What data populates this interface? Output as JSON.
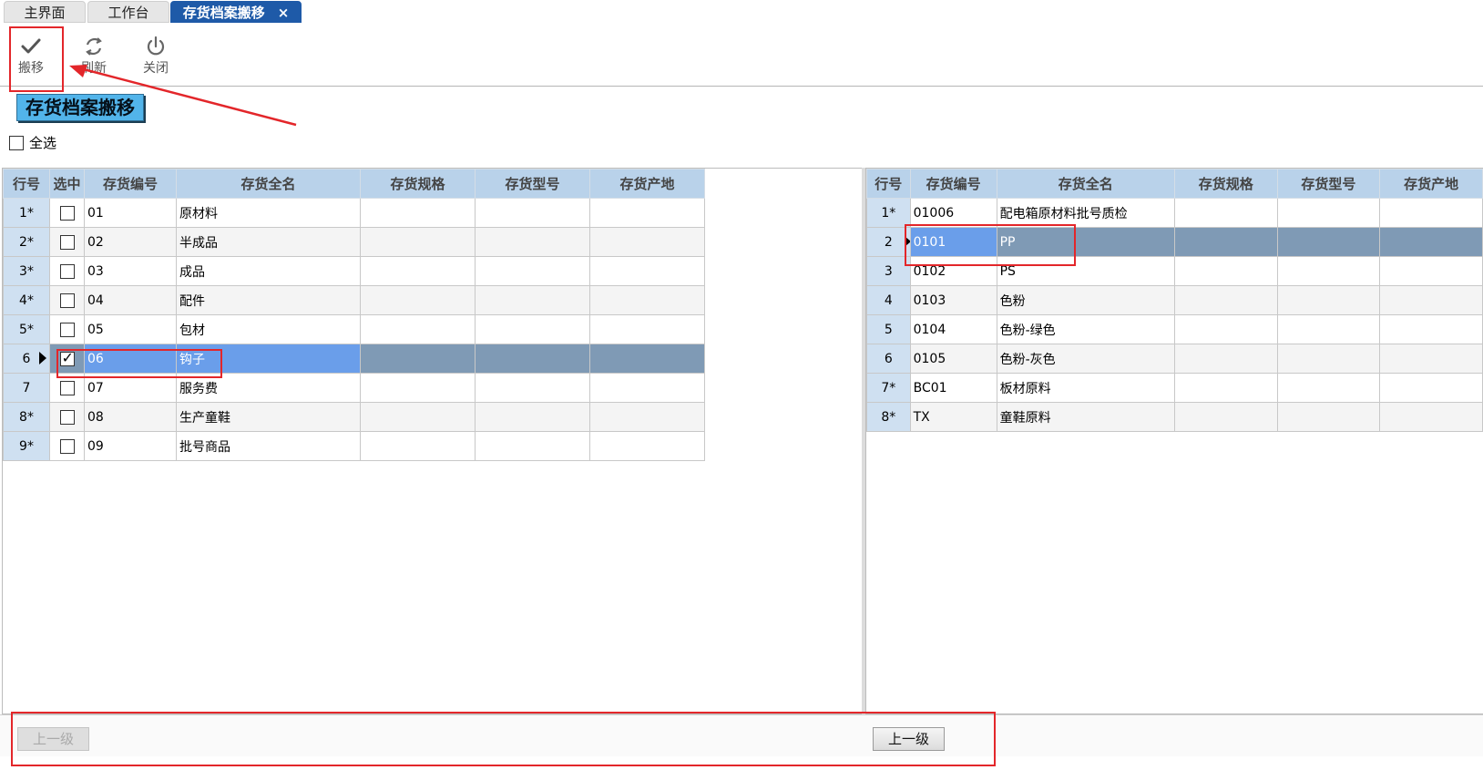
{
  "tabs": [
    {
      "label": "主界面",
      "active": false
    },
    {
      "label": "工作台",
      "active": false
    },
    {
      "label": "存货档案搬移",
      "active": true
    }
  ],
  "tab_close_glyph": "×",
  "toolbar": [
    {
      "label": "搬移",
      "icon": "check-icon"
    },
    {
      "label": "刷新",
      "icon": "refresh-icon"
    },
    {
      "label": "关闭",
      "icon": "power-icon"
    }
  ],
  "page_title": "存货档案搬移",
  "select_all_label": "全选",
  "left_grid": {
    "columns": [
      "行号",
      "选中",
      "存货编号",
      "存货全名",
      "存货规格",
      "存货型号",
      "存货产地"
    ],
    "rows": [
      {
        "rn": "1*",
        "checked": false,
        "code": "01",
        "name": "原材料",
        "spec": "",
        "model": "",
        "origin": ""
      },
      {
        "rn": "2*",
        "checked": false,
        "code": "02",
        "name": "半成品",
        "spec": "",
        "model": "",
        "origin": ""
      },
      {
        "rn": "3*",
        "checked": false,
        "code": "03",
        "name": "成品",
        "spec": "",
        "model": "",
        "origin": ""
      },
      {
        "rn": "4*",
        "checked": false,
        "code": "04",
        "name": "配件",
        "spec": "",
        "model": "",
        "origin": ""
      },
      {
        "rn": "5*",
        "checked": false,
        "code": "05",
        "name": "包材",
        "spec": "",
        "model": "",
        "origin": ""
      },
      {
        "rn": "6",
        "checked": true,
        "code": "06",
        "name": "钩子",
        "spec": "",
        "model": "",
        "origin": "",
        "current": true
      },
      {
        "rn": "7",
        "checked": false,
        "code": "07",
        "name": "服务费",
        "spec": "",
        "model": "",
        "origin": ""
      },
      {
        "rn": "8*",
        "checked": false,
        "code": "08",
        "name": "生产童鞋",
        "spec": "",
        "model": "",
        "origin": ""
      },
      {
        "rn": "9*",
        "checked": false,
        "code": "09",
        "name": "批号商品",
        "spec": "",
        "model": "",
        "origin": ""
      }
    ]
  },
  "right_grid": {
    "columns": [
      "行号",
      "存货编号",
      "存货全名",
      "存货规格",
      "存货型号",
      "存货产地"
    ],
    "rows": [
      {
        "rn": "1*",
        "code": "01006",
        "name": "配电箱原材料批号质检",
        "spec": "",
        "model": "",
        "origin": ""
      },
      {
        "rn": "2",
        "code": "0101",
        "name": "PP",
        "spec": "",
        "model": "",
        "origin": "",
        "current": true
      },
      {
        "rn": "3",
        "code": "0102",
        "name": "PS",
        "spec": "",
        "model": "",
        "origin": ""
      },
      {
        "rn": "4",
        "code": "0103",
        "name": "色粉",
        "spec": "",
        "model": "",
        "origin": ""
      },
      {
        "rn": "5",
        "code": "0104",
        "name": "色粉-绿色",
        "spec": "",
        "model": "",
        "origin": ""
      },
      {
        "rn": "6",
        "code": "0105",
        "name": "色粉-灰色",
        "spec": "",
        "model": "",
        "origin": ""
      },
      {
        "rn": "7*",
        "code": "BC01",
        "name": "板材原料",
        "spec": "",
        "model": "",
        "origin": ""
      },
      {
        "rn": "8*",
        "code": "TX",
        "name": "童鞋原料",
        "spec": "",
        "model": "",
        "origin": ""
      }
    ]
  },
  "left_up_button": {
    "label": "上一级",
    "disabled": true
  },
  "right_up_button": {
    "label": "上一级",
    "disabled": false
  },
  "colors": {
    "accent": "#1e5aa8",
    "highlight": "#7f9ab5",
    "annotation": "#e3262a"
  }
}
